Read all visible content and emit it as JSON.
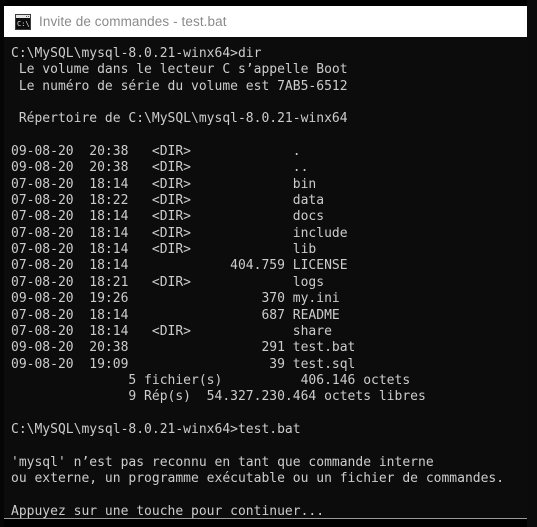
{
  "window": {
    "title": "Invite de commandes - test.bat",
    "icon": "command-prompt-icon",
    "background_color": "#0c0c0c",
    "titlebar_color": "#ffffff",
    "titlebar_text_color": "#8a8a8a",
    "text_color": "#cccccc"
  },
  "console": {
    "prompt_path": "C:\\MySQL\\mysql-8.0.21-winx64",
    "commands": [
      {
        "prompt": "C:\\MySQL\\mysql-8.0.21-winx64>",
        "command": "dir"
      },
      {
        "prompt": "C:\\MySQL\\mysql-8.0.21-winx64>",
        "command": "test.bat"
      }
    ],
    "volume_label_line": " Le volume dans le lecteur C s’appelle Boot",
    "volume_serial_line": " Le numéro de série du volume est 7AB5-6512",
    "directory_header": " Répertoire de C:\\MySQL\\mysql-8.0.21-winx64",
    "listing_columns": [
      "date",
      "time",
      "size",
      "name"
    ],
    "listing": [
      {
        "date": "09-08-20",
        "time": "20:38",
        "size": "<DIR>",
        "name": "."
      },
      {
        "date": "09-08-20",
        "time": "20:38",
        "size": "<DIR>",
        "name": ".."
      },
      {
        "date": "07-08-20",
        "time": "18:14",
        "size": "<DIR>",
        "name": "bin"
      },
      {
        "date": "07-08-20",
        "time": "18:22",
        "size": "<DIR>",
        "name": "data"
      },
      {
        "date": "07-08-20",
        "time": "18:14",
        "size": "<DIR>",
        "name": "docs"
      },
      {
        "date": "07-08-20",
        "time": "18:14",
        "size": "<DIR>",
        "name": "include"
      },
      {
        "date": "07-08-20",
        "time": "18:14",
        "size": "<DIR>",
        "name": "lib"
      },
      {
        "date": "07-08-20",
        "time": "18:14",
        "size": "404.759",
        "name": "LICENSE"
      },
      {
        "date": "07-08-20",
        "time": "18:21",
        "size": "<DIR>",
        "name": "logs"
      },
      {
        "date": "09-08-20",
        "time": "19:26",
        "size": "370",
        "name": "my.ini"
      },
      {
        "date": "07-08-20",
        "time": "18:14",
        "size": "687",
        "name": "README"
      },
      {
        "date": "07-08-20",
        "time": "18:14",
        "size": "<DIR>",
        "name": "share"
      },
      {
        "date": "09-08-20",
        "time": "20:38",
        "size": "291",
        "name": "test.bat"
      },
      {
        "date": "09-08-20",
        "time": "19:09",
        "size": "39",
        "name": "test.sql"
      }
    ],
    "summary_files": "               5 fichier(s)          406.146 octets",
    "summary_dirs": "               9 Rép(s)  54.327.230.464 octets libres",
    "error_line_1": "'mysql' n’est pas reconnu en tant que commande interne",
    "error_line_2": "ou externe, un programme exécutable ou un fichier de commandes.",
    "pause_message": "Appuyez sur une touche pour continuer..."
  }
}
